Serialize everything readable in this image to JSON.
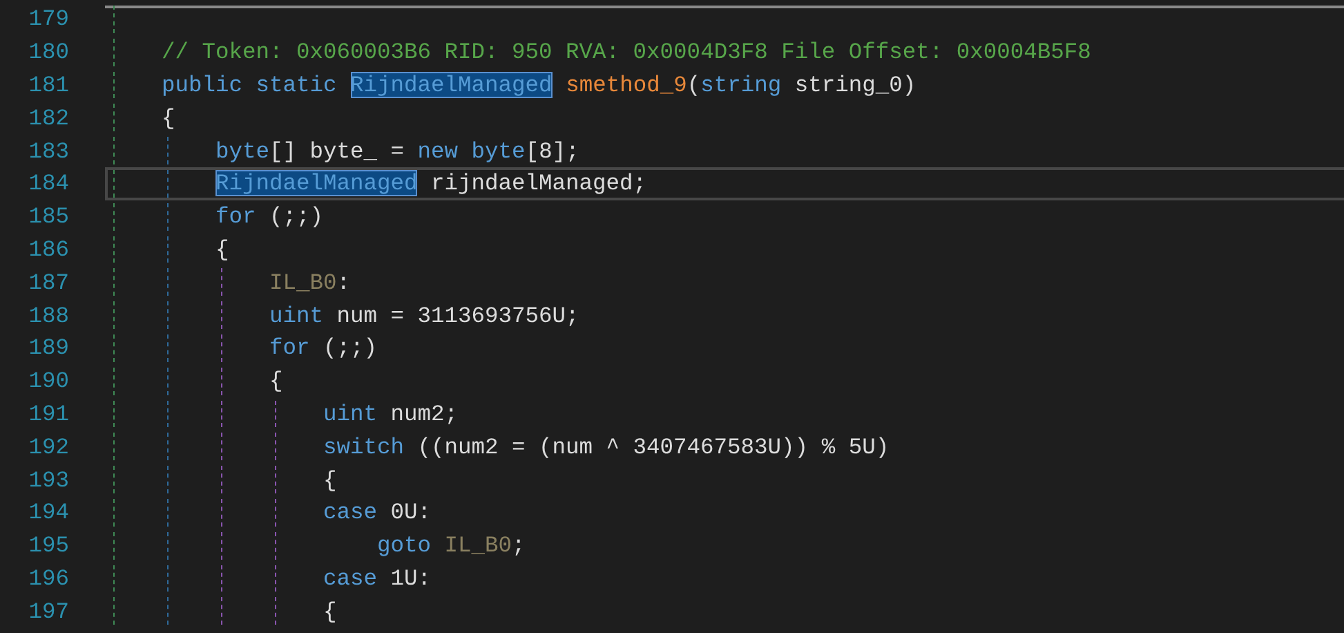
{
  "editor": {
    "lines": [
      {
        "number": "179",
        "current": false
      },
      {
        "number": "180",
        "current": false,
        "tokens": [
          {
            "text": "// Token: 0x060003B6 RID: 950 RVA: 0x0004D3F8 File Offset: 0x0004B5F8",
            "kind": "comment",
            "highlighted": false
          }
        ]
      },
      {
        "number": "181",
        "current": false,
        "tokens": [
          {
            "text": "public static ",
            "kind": "keyword",
            "highlighted": false
          },
          {
            "text": "RijndaelManaged",
            "kind": "keyword",
            "highlighted": true
          },
          {
            "text": " smethod_9",
            "kind": "method",
            "highlighted": false
          },
          {
            "text": "(",
            "kind": "plain",
            "highlighted": false
          },
          {
            "text": "string",
            "kind": "keyword",
            "highlighted": false
          },
          {
            "text": " string_0)",
            "kind": "plain",
            "highlighted": false
          }
        ]
      },
      {
        "number": "182",
        "current": false,
        "tokens": [
          {
            "text": "{",
            "kind": "plain",
            "highlighted": false
          }
        ],
        "children": [
          {
            "number": "183",
            "current": false,
            "tokens": [
              {
                "text": "byte",
                "kind": "keyword",
                "highlighted": false
              },
              {
                "text": "[] byte_ = ",
                "kind": "plain",
                "highlighted": false
              },
              {
                "text": "new byte",
                "kind": "keyword",
                "highlighted": false
              },
              {
                "text": "[8];",
                "kind": "plain",
                "highlighted": false
              }
            ]
          },
          {
            "number": "184",
            "current": true,
            "tokens": [
              {
                "text": "RijndaelManaged",
                "kind": "keyword",
                "highlighted": true
              },
              {
                "text": " rijndaelManaged;",
                "kind": "plain",
                "highlighted": false
              }
            ]
          },
          {
            "number": "185",
            "current": false,
            "tokens": [
              {
                "text": "for",
                "kind": "keyword",
                "highlighted": false
              },
              {
                "text": " (;;)",
                "kind": "plain",
                "highlighted": false
              }
            ]
          },
          {
            "number": "186",
            "current": false,
            "tokens": [
              {
                "text": "{",
                "kind": "plain",
                "highlighted": false
              }
            ],
            "children": [
              {
                "number": "187",
                "current": false,
                "tokens": [
                  {
                    "text": "IL_B0",
                    "kind": "label",
                    "highlighted": false
                  },
                  {
                    "text": ":",
                    "kind": "plain",
                    "highlighted": false
                  }
                ]
              },
              {
                "number": "188",
                "current": false,
                "tokens": [
                  {
                    "text": "uint",
                    "kind": "keyword",
                    "highlighted": false
                  },
                  {
                    "text": " num = 3113693756U;",
                    "kind": "plain",
                    "highlighted": false
                  }
                ]
              },
              {
                "number": "189",
                "current": false,
                "tokens": [
                  {
                    "text": "for",
                    "kind": "keyword",
                    "highlighted": false
                  },
                  {
                    "text": " (;;)",
                    "kind": "plain",
                    "highlighted": false
                  }
                ]
              },
              {
                "number": "190",
                "current": false,
                "tokens": [
                  {
                    "text": "{",
                    "kind": "plain",
                    "highlighted": false
                  }
                ],
                "children": [
                  {
                    "number": "191",
                    "current": false,
                    "tokens": [
                      {
                        "text": "uint",
                        "kind": "keyword",
                        "highlighted": false
                      },
                      {
                        "text": " num2;",
                        "kind": "plain",
                        "highlighted": false
                      }
                    ]
                  },
                  {
                    "number": "192",
                    "current": false,
                    "tokens": [
                      {
                        "text": "switch",
                        "kind": "keyword",
                        "highlighted": false
                      },
                      {
                        "text": " ((num2 = (num ^ 3407467583U)) % 5U)",
                        "kind": "plain",
                        "highlighted": false
                      }
                    ]
                  },
                  {
                    "number": "193",
                    "current": false,
                    "tokens": [
                      {
                        "text": "{",
                        "kind": "plain",
                        "highlighted": false
                      }
                    ]
                  },
                  {
                    "number": "194",
                    "current": false,
                    "tokens": [
                      {
                        "text": "case",
                        "kind": "keyword",
                        "highlighted": false
                      },
                      {
                        "text": " 0U:",
                        "kind": "plain",
                        "highlighted": false
                      }
                    ],
                    "children": [
                      {
                        "number": "195",
                        "current": false,
                        "tokens": [
                          {
                            "text": "goto ",
                            "kind": "keyword",
                            "highlighted": false
                          },
                          {
                            "text": "IL_B0",
                            "kind": "label",
                            "highlighted": false
                          },
                          {
                            "text": ";",
                            "kind": "plain",
                            "highlighted": false
                          }
                        ]
                      }
                    ]
                  },
                  {
                    "number": "196",
                    "current": false,
                    "tokens": [
                      {
                        "text": "case",
                        "kind": "keyword",
                        "highlighted": false
                      },
                      {
                        "text": " 1U:",
                        "kind": "plain",
                        "highlighted": false
                      }
                    ]
                  },
                  {
                    "number": "197",
                    "current": false,
                    "tokens": [
                      {
                        "text": "{",
                        "kind": "plain",
                        "highlighted": false
                      }
                    ]
                  }
                ]
              }
            ]
          }
        ]
      }
    ]
  }
}
